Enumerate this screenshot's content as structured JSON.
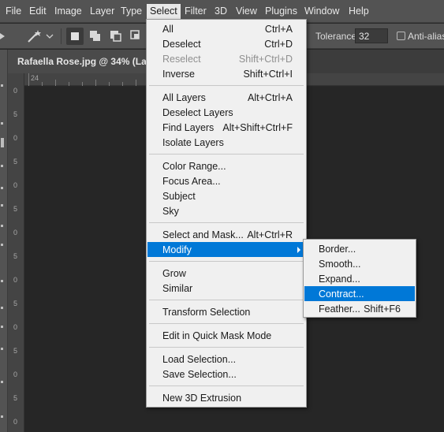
{
  "menubar": {
    "items": [
      "File",
      "Edit",
      "Image",
      "Layer",
      "Type",
      "Select",
      "Filter",
      "3D",
      "View",
      "Plugins",
      "Window",
      "Help"
    ],
    "active": "Select"
  },
  "options": {
    "tolerance_label": "Tolerance:",
    "tolerance_value": "32",
    "anti_alias_label": "Anti-alias"
  },
  "document": {
    "tab_title": "Rafaella Rose.jpg @ 34% (Layer"
  },
  "rulers": {
    "top_label": "24",
    "left_labels": [
      "0",
      "5",
      "0",
      "5",
      "0",
      "5",
      "0",
      "5",
      "0",
      "5",
      "0",
      "5",
      "0",
      "5",
      "0"
    ]
  },
  "select_menu": {
    "groups": [
      [
        {
          "label": "All",
          "shortcut": "Ctrl+A"
        },
        {
          "label": "Deselect",
          "shortcut": "Ctrl+D"
        },
        {
          "label": "Reselect",
          "shortcut": "Shift+Ctrl+D",
          "disabled": true
        },
        {
          "label": "Inverse",
          "shortcut": "Shift+Ctrl+I"
        }
      ],
      [
        {
          "label": "All Layers",
          "shortcut": "Alt+Ctrl+A"
        },
        {
          "label": "Deselect Layers",
          "shortcut": ""
        },
        {
          "label": "Find Layers",
          "shortcut": "Alt+Shift+Ctrl+F"
        },
        {
          "label": "Isolate Layers",
          "shortcut": ""
        }
      ],
      [
        {
          "label": "Color Range...",
          "shortcut": ""
        },
        {
          "label": "Focus Area...",
          "shortcut": ""
        },
        {
          "label": "Subject",
          "shortcut": ""
        },
        {
          "label": "Sky",
          "shortcut": ""
        }
      ],
      [
        {
          "label": "Select and Mask...",
          "shortcut": "Alt+Ctrl+R"
        },
        {
          "label": "Modify",
          "shortcut": "",
          "submenu": true,
          "highlighted": true
        }
      ],
      [
        {
          "label": "Grow",
          "shortcut": ""
        },
        {
          "label": "Similar",
          "shortcut": ""
        }
      ],
      [
        {
          "label": "Transform Selection",
          "shortcut": ""
        }
      ],
      [
        {
          "label": "Edit in Quick Mask Mode",
          "shortcut": ""
        }
      ],
      [
        {
          "label": "Load Selection...",
          "shortcut": ""
        },
        {
          "label": "Save Selection...",
          "shortcut": ""
        }
      ],
      [
        {
          "label": "New 3D Extrusion",
          "shortcut": ""
        }
      ]
    ]
  },
  "modify_submenu": {
    "items": [
      {
        "label": "Border...",
        "shortcut": ""
      },
      {
        "label": "Smooth...",
        "shortcut": ""
      },
      {
        "label": "Expand...",
        "shortcut": ""
      },
      {
        "label": "Contract...",
        "shortcut": "",
        "highlighted": true
      },
      {
        "label": "Feather...",
        "shortcut": "Shift+F6"
      }
    ]
  },
  "colors": {
    "highlight": "#0078d7",
    "menu_bg": "#f0f0f0",
    "chrome": "#535353",
    "canvas": "#262626"
  },
  "icons": [
    "workspace-icon",
    "magic-wand-icon",
    "new-selection-icon",
    "add-selection-icon",
    "subtract-selection-icon",
    "intersect-selection-icon",
    "submenu-arrow-icon"
  ]
}
